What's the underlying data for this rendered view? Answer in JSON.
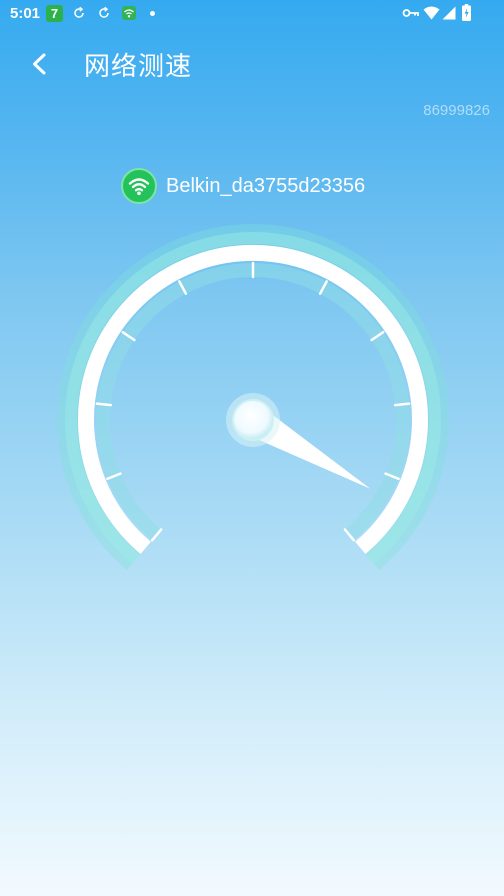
{
  "status_bar": {
    "time": "5:01",
    "badge_number": "7"
  },
  "header": {
    "title": "网络测速",
    "device_id": "86999826"
  },
  "network": {
    "ssid": "Belkin_da3755d23356"
  },
  "gauge": {
    "tick_count": 11,
    "needle_fraction": 0.93
  },
  "colors": {
    "gradient_top": "#35aaf0",
    "gradient_bottom": "#f2fafe",
    "gauge_glow": "#7fe2d8",
    "wifi_green": "#24c25a"
  }
}
